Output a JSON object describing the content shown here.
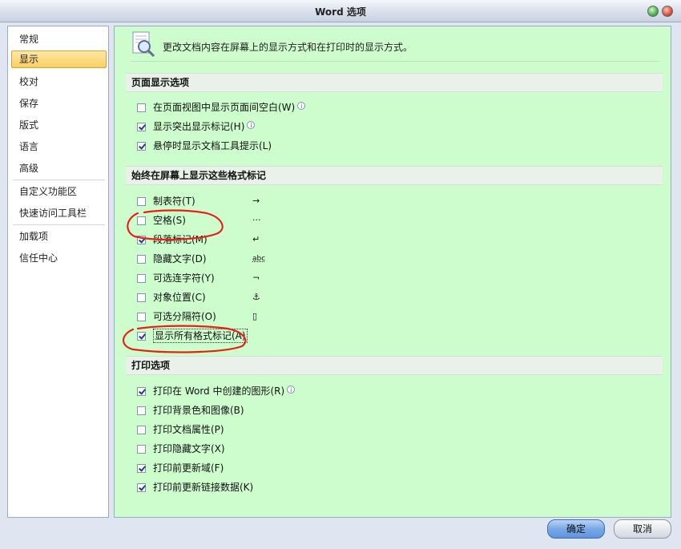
{
  "window": {
    "title": "Word 选项"
  },
  "nav": {
    "items": [
      {
        "label": "常规"
      },
      {
        "label": "显示"
      },
      {
        "label": "校对"
      },
      {
        "label": "保存"
      },
      {
        "label": "版式"
      },
      {
        "label": "语言"
      },
      {
        "label": "高级"
      },
      {
        "label": "自定义功能区"
      },
      {
        "label": "快速访问工具栏"
      },
      {
        "label": "加载项"
      },
      {
        "label": "信任中心"
      }
    ],
    "selected": "显示"
  },
  "content": {
    "header": "更改文档内容在屏幕上的显示方式和在打印时的显示方式。",
    "sections": [
      {
        "title": "页面显示选项",
        "options": [
          {
            "label": "在页面视图中显示页面间空白(W)",
            "checked": false,
            "info": true
          },
          {
            "label": "显示突出显示标记(H)",
            "checked": true,
            "info": true
          },
          {
            "label": "悬停时显示文档工具提示(L)",
            "checked": true,
            "info": false
          }
        ]
      },
      {
        "title": "始终在屏幕上显示这些格式标记",
        "options": [
          {
            "label": "制表符(T)",
            "checked": false,
            "mark": "→"
          },
          {
            "label": "空格(S)",
            "checked": false,
            "mark": "···"
          },
          {
            "label": "段落标记(M)",
            "checked": true,
            "mark": "↵"
          },
          {
            "label": "隐藏文字(D)",
            "checked": false,
            "mark": "abc"
          },
          {
            "label": "可选连字符(Y)",
            "checked": false,
            "mark": "¬"
          },
          {
            "label": "对象位置(C)",
            "checked": false,
            "mark": "⚓"
          },
          {
            "label": "可选分隔符(O)",
            "checked": false,
            "mark": "▯"
          },
          {
            "label": "显示所有格式标记(A)",
            "checked": true,
            "mark": ""
          }
        ]
      },
      {
        "title": "打印选项",
        "options": [
          {
            "label": "打印在 Word 中创建的图形(R)",
            "checked": true,
            "info": true
          },
          {
            "label": "打印背景色和图像(B)",
            "checked": false
          },
          {
            "label": "打印文档属性(P)",
            "checked": false
          },
          {
            "label": "打印隐藏文字(X)",
            "checked": false
          },
          {
            "label": "打印前更新域(F)",
            "checked": true
          },
          {
            "label": "打印前更新链接数据(K)",
            "checked": true
          }
        ]
      }
    ]
  },
  "footer": {
    "ok_label": "确定",
    "cancel_label": "取消"
  },
  "colors": {
    "content_bg": "#cdfccd",
    "annotation": "#e8201a",
    "ok_button": "#7aa8e6"
  }
}
